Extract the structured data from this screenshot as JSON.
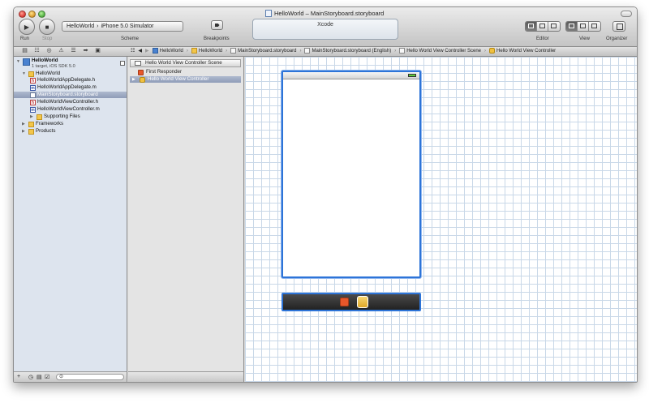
{
  "window": {
    "title": "HelloWorld – MainStoryboard.storyboard"
  },
  "toolbar": {
    "run_label": "Run",
    "stop_label": "Stop",
    "scheme_label": "Scheme",
    "scheme_target": "HelloWorld",
    "scheme_destination": "iPhone 5.0 Simulator",
    "scheme_separator": "›",
    "breakpoints_label": "Breakpoints",
    "activity_text": "Xcode",
    "editor_label": "Editor",
    "view_label": "View",
    "organizer_label": "Organizer"
  },
  "jumpbar": {
    "items": [
      "HelloWorld",
      "HelloWorld",
      "MainStoryboard.storyboard",
      "MainStoryboard.storyboard (English)",
      "Hello World View Controller Scene",
      "Hello World View Controller"
    ],
    "separator": "›"
  },
  "navigator": {
    "project_name": "HelloWorld",
    "project_subtitle": "1 target, iOS SDK 5.0",
    "group_name": "HelloWorld",
    "files": [
      {
        "name": "HelloWorldAppDelegate.h",
        "kind": "h"
      },
      {
        "name": "HelloWorldAppDelegate.m",
        "kind": "m"
      },
      {
        "name": "MainStoryboard.storyboard",
        "kind": "storyboard"
      },
      {
        "name": "HelloWorldViewController.h",
        "kind": "h"
      },
      {
        "name": "HelloWorldViewController.m",
        "kind": "m"
      }
    ],
    "supporting_files": "Supporting Files",
    "frameworks": "Frameworks",
    "products": "Products",
    "file_letters": {
      "h": "h",
      "m": "m"
    }
  },
  "outline": {
    "scene_name": "Hello World View Controller Scene",
    "first_responder": "First Responder",
    "view_controller": "Hello World View Controller"
  },
  "colors": {
    "selection_blue": "#2d74d8",
    "navigator_bg": "#dde4ee"
  }
}
